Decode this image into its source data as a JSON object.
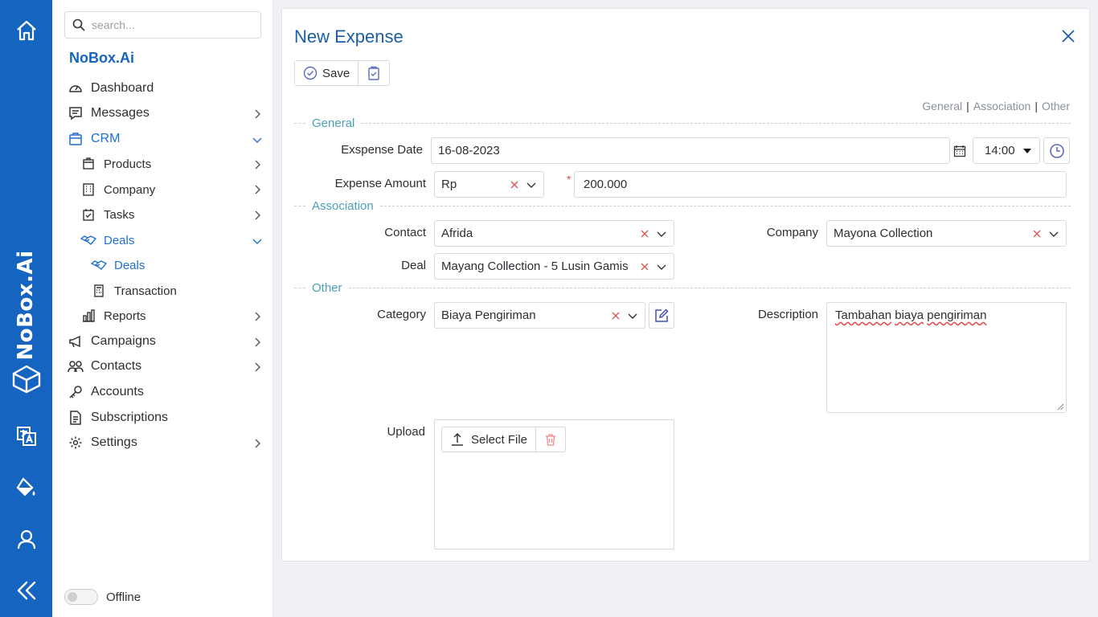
{
  "rail": {
    "brand": "NoBox.Ai",
    "icons": [
      "home-icon",
      "cube-logo-icon",
      "translate-icon",
      "paint-bucket-icon",
      "user-icon",
      "collapse-icon"
    ]
  },
  "sidebar": {
    "search_placeholder": "search...",
    "brand": "NoBox.Ai",
    "items": {
      "dashboard": "Dashboard",
      "messages": "Messages",
      "crm": "CRM",
      "products": "Products",
      "company": "Company",
      "tasks": "Tasks",
      "deals_group": "Deals",
      "deals": "Deals",
      "transaction": "Transaction",
      "reports": "Reports",
      "campaigns": "Campaigns",
      "contacts": "Contacts",
      "accounts": "Accounts",
      "subscriptions": "Subscriptions",
      "settings": "Settings"
    },
    "offline_label": "Offline"
  },
  "form": {
    "title": "New Expense",
    "save_label": "Save",
    "anchors": [
      "General",
      "Association",
      "Other"
    ],
    "sections": {
      "general": "General",
      "association": "Association",
      "other": "Other"
    },
    "labels": {
      "expense_date": "Exspense Date",
      "expense_amount": "Expense Amount",
      "contact": "Contact",
      "company": "Company",
      "deal": "Deal",
      "category": "Category",
      "description": "Description",
      "upload": "Upload"
    },
    "values": {
      "expense_date": "16-08-2023",
      "time": "14:00",
      "currency": "Rp",
      "amount": "200.000",
      "contact": "Afrida",
      "company": "Mayona Collection",
      "deal": "Mayang Collection - 5 Lusin Gamis",
      "category": "Biaya Pengiriman",
      "description_words": [
        "Tambahan",
        "biaya",
        "pengiriman"
      ]
    },
    "time_options": [
      "14:00"
    ],
    "select_file_label": "Select File"
  },
  "colors": {
    "rail": "#1565c0",
    "accent": "#1e6fd0",
    "section": "#4aa0b5",
    "clear": "#d9534f"
  }
}
